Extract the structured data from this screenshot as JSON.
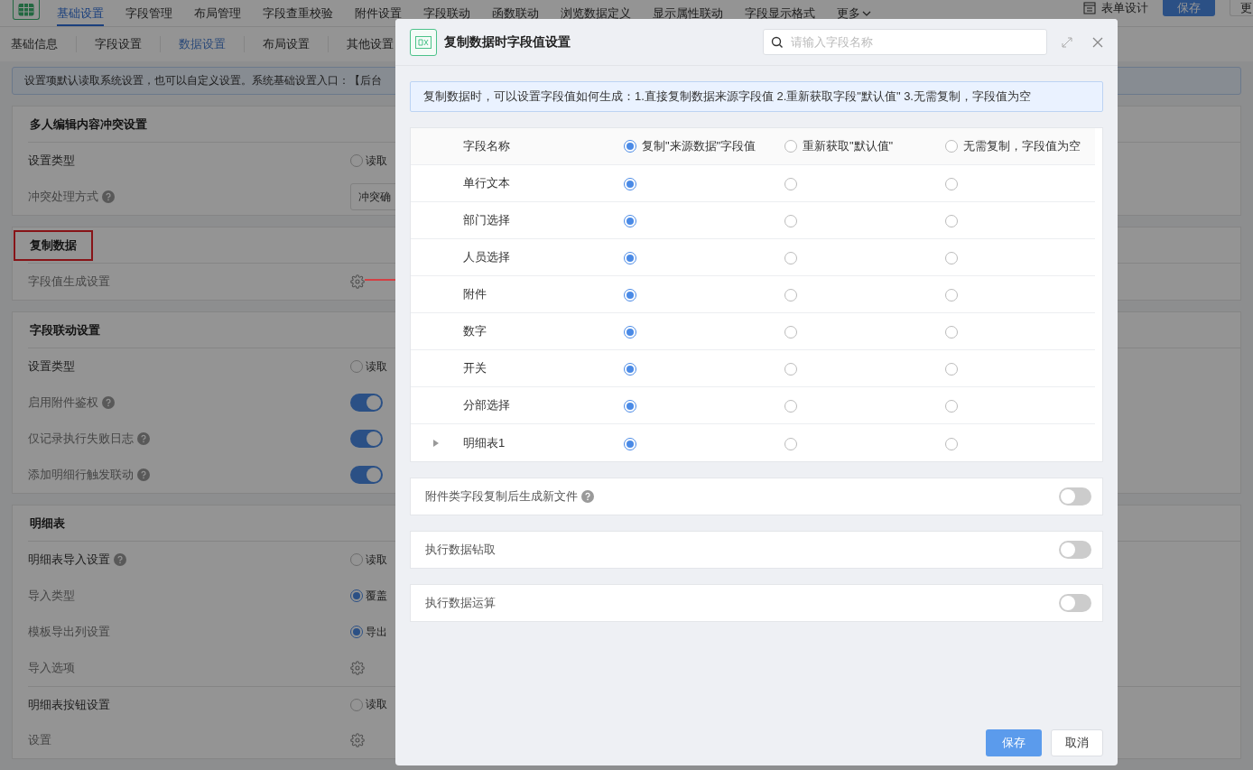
{
  "header": {
    "nav_tabs": [
      {
        "label": "基础设置",
        "selected": true
      },
      {
        "label": "字段管理",
        "selected": false
      },
      {
        "label": "布局管理",
        "selected": false
      },
      {
        "label": "字段查重校验",
        "selected": false
      },
      {
        "label": "附件设置",
        "selected": false
      },
      {
        "label": "字段联动",
        "selected": false
      },
      {
        "label": "函数联动",
        "selected": false
      },
      {
        "label": "浏览数据定义",
        "selected": false
      },
      {
        "label": "显示属性联动",
        "selected": false
      },
      {
        "label": "字段显示格式",
        "selected": false
      },
      {
        "label": "更多",
        "selected": false
      }
    ],
    "design_button": "表单设计",
    "save_button": "保存",
    "more_button": "更"
  },
  "sub_tabs": [
    {
      "label": "基础信息",
      "selected": false
    },
    {
      "label": "字段设置",
      "selected": false
    },
    {
      "label": "数据设置",
      "selected": true
    },
    {
      "label": "布局设置",
      "selected": false
    },
    {
      "label": "其他设置",
      "selected": false
    }
  ],
  "notice": "设置项默认读取系统设置，也可以自定义设置。系统基础设置入口：【后台",
  "sections": [
    {
      "title": "多人编辑内容冲突设置",
      "highlighted": false,
      "rows": [
        {
          "label": "设置类型",
          "primary": true,
          "help": false,
          "kind": "radio",
          "value": "读取",
          "checked": false
        },
        {
          "label": "冲突处理方式",
          "primary": false,
          "help": true,
          "kind": "select",
          "value": "冲突确"
        }
      ]
    },
    {
      "title": "复制数据",
      "highlighted": true,
      "rows": [
        {
          "label": "字段值生成设置",
          "primary": false,
          "help": false,
          "kind": "gear"
        }
      ]
    },
    {
      "title": "字段联动设置",
      "highlighted": false,
      "rows": [
        {
          "label": "设置类型",
          "primary": true,
          "help": false,
          "kind": "radio",
          "value": "读取",
          "checked": false
        },
        {
          "label": "启用附件鉴权",
          "primary": false,
          "help": true,
          "kind": "toggle",
          "on": true
        },
        {
          "label": "仅记录执行失败日志",
          "primary": false,
          "help": true,
          "kind": "toggle",
          "on": true
        },
        {
          "label": "添加明细行触发联动",
          "primary": false,
          "help": true,
          "kind": "toggle",
          "on": true
        }
      ]
    },
    {
      "title": "明细表",
      "highlighted": false,
      "rows": [
        {
          "label": "明细表导入设置",
          "primary": true,
          "help": true,
          "kind": "radio",
          "value": "读取",
          "checked": false
        },
        {
          "label": "导入类型",
          "primary": false,
          "help": false,
          "kind": "radio",
          "value": "覆盖",
          "checked": true
        },
        {
          "label": "模板导出列设置",
          "primary": false,
          "help": false,
          "kind": "radio",
          "value": "导出",
          "checked": true
        },
        {
          "label": "导入选项",
          "primary": false,
          "help": false,
          "kind": "gear"
        },
        {
          "label": "明细表按钮设置",
          "primary": true,
          "help": false,
          "kind": "radio",
          "value": "读取",
          "checked": false,
          "divider_before": true
        },
        {
          "label": "设置",
          "primary": false,
          "help": false,
          "kind": "gear"
        }
      ]
    }
  ],
  "modal": {
    "title": "复制数据时字段值设置",
    "search_placeholder": "请输入字段名称",
    "info": "复制数据时，可以设置字段值如何生成：1.直接复制数据来源字段值 2.重新获取字段\"默认值\" 3.无需复制，字段值为空",
    "table": {
      "name_header": "字段名称",
      "options": [
        {
          "label": "复制\"来源数据\"字段值",
          "selected": true
        },
        {
          "label": "重新获取\"默认值\"",
          "selected": false
        },
        {
          "label": "无需复制，字段值为空",
          "selected": false
        }
      ],
      "rows": [
        {
          "name": "单行文本",
          "expandable": false,
          "choices": [
            {
              "selected": true
            },
            {
              "selected": false
            },
            {
              "selected": false
            }
          ]
        },
        {
          "name": "部门选择",
          "expandable": false,
          "choices": [
            {
              "selected": true
            },
            {
              "selected": false
            },
            {
              "selected": false
            }
          ]
        },
        {
          "name": "人员选择",
          "expandable": false,
          "choices": [
            {
              "selected": true
            },
            {
              "selected": false
            },
            {
              "selected": false
            }
          ]
        },
        {
          "name": "附件",
          "expandable": false,
          "choices": [
            {
              "selected": true
            },
            {
              "selected": false
            },
            {
              "selected": false
            }
          ]
        },
        {
          "name": "数字",
          "expandable": false,
          "choices": [
            {
              "selected": true
            },
            {
              "selected": false
            },
            {
              "selected": false
            }
          ]
        },
        {
          "name": "开关",
          "expandable": false,
          "choices": [
            {
              "selected": true
            },
            {
              "selected": false
            },
            {
              "selected": false
            }
          ]
        },
        {
          "name": "分部选择",
          "expandable": false,
          "choices": [
            {
              "selected": true
            },
            {
              "selected": false
            },
            {
              "selected": false
            }
          ]
        },
        {
          "name": "明细表1",
          "expandable": true,
          "choices": [
            {
              "selected": true
            },
            {
              "selected": false
            },
            {
              "selected": false
            }
          ]
        }
      ]
    },
    "settings": [
      {
        "label": "附件类字段复制后生成新文件",
        "help": true,
        "on": false
      },
      {
        "label": "执行数据钻取",
        "help": false,
        "on": false
      },
      {
        "label": "执行数据运算",
        "help": false,
        "on": false
      }
    ],
    "save_button": "保存",
    "cancel_button": "取消"
  }
}
